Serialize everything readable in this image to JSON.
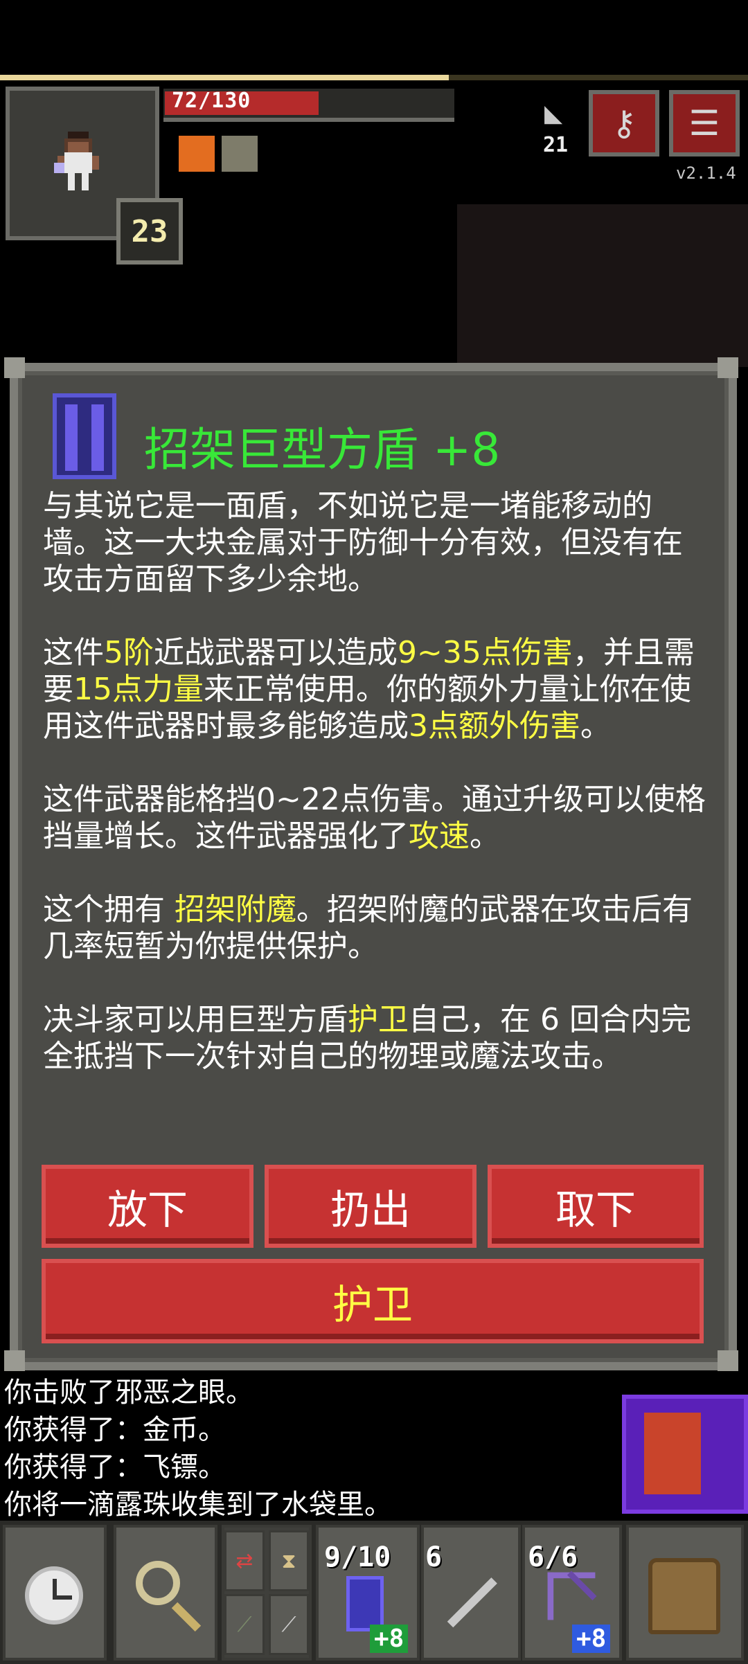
{
  "hud": {
    "hp_text": "72/130",
    "hp_fraction": 0.554,
    "xp_fraction": 0.6,
    "level": "23",
    "depth": "21",
    "version": "v2.1.4",
    "buffs": [
      "buff-orange-icon",
      "buff-gray-icon"
    ]
  },
  "item": {
    "icon": "greatshield-icon",
    "title": "招架巨型方盾 +8",
    "desc": {
      "p1": "与其说它是一面盾，不如说它是一堵能移动的墙。这一大块金属对于防御十分有效，但没有在攻击方面留下多少余地。",
      "p2": {
        "a": "这件",
        "b": "5阶",
        "c": "近战武器可以造成",
        "d": "9~35点伤害",
        "e": "，并且需要",
        "f": "15点力量",
        "g": "来正常使用。你的额外力量让你在使用这件武器时最多能够造成",
        "h": "3点额外伤害",
        "i": "。"
      },
      "p3": {
        "a": "这件武器能格挡0~22点伤害。通过升级可以使格挡量增长。这件武器强化了",
        "b": "攻速",
        "c": "。"
      },
      "p4": {
        "a": "这个拥有 ",
        "b": "招架附魔",
        "c": "。招架附魔的武器在攻击后有几率短暂为你提供保护。"
      },
      "p5": {
        "a": "决斗家可以用巨型方盾",
        "b": "护卫",
        "c": "自己，在 6 回合内完全抵挡下一次针对自己的物理或魔法攻击。"
      }
    },
    "buttons": {
      "drop": "放下",
      "throw": "扔出",
      "unequip": "取下",
      "guard": "护卫"
    }
  },
  "log": [
    "你击败了邪恶之眼。",
    "你获得了：金币。",
    "你获得了：飞镖。",
    "你将一滴露珠收集到了水袋里。"
  ],
  "toolbar": {
    "slot1": {
      "count": "9/10",
      "bonus": "+8",
      "bonus_color": "#1f9d3a"
    },
    "slot2": {
      "count": "6"
    },
    "slot3": {
      "count": "6/6",
      "bonus": "+8",
      "bonus_color": "#2f5be0"
    }
  },
  "colors": {
    "title_green": "#38e838",
    "highlight_yellow": "#ffff44",
    "button_red": "#c63232",
    "panel_gray": "#4b4b47"
  }
}
